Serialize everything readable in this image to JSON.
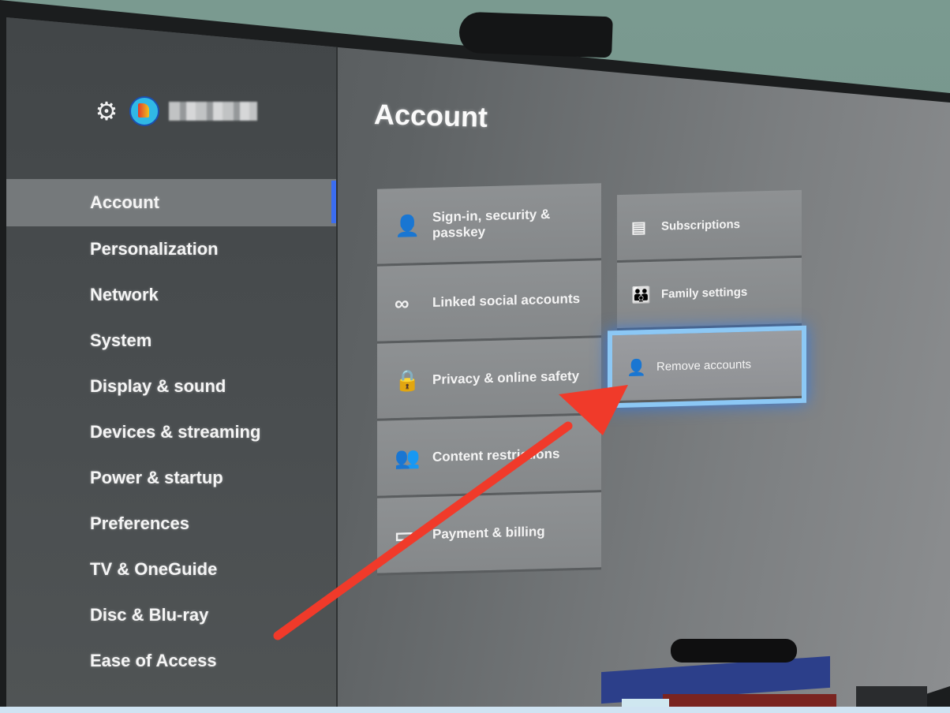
{
  "header": {
    "settings_icon": "gear-icon",
    "gamertag": "(blurred gamertag)"
  },
  "sidebar": {
    "items": [
      {
        "label": "Account",
        "selected": true
      },
      {
        "label": "Personalization"
      },
      {
        "label": "Network"
      },
      {
        "label": "System"
      },
      {
        "label": "Display & sound"
      },
      {
        "label": "Devices & streaming"
      },
      {
        "label": "Power & startup"
      },
      {
        "label": "Preferences"
      },
      {
        "label": "TV & OneGuide"
      },
      {
        "label": "Disc & Blu-ray"
      },
      {
        "label": "Ease of Access"
      }
    ],
    "accent_color": "#3b6df0"
  },
  "main": {
    "title": "Account",
    "left_tiles": [
      {
        "label": "Sign-in, security & passkey",
        "icon": "user-arrow-icon"
      },
      {
        "label": "Linked social accounts",
        "icon": "link-icon"
      },
      {
        "label": "Privacy & online safety",
        "icon": "lock-icon"
      },
      {
        "label": "Content restrictions",
        "icon": "family-lock-icon"
      },
      {
        "label": "Payment & billing",
        "icon": "wallet-icon"
      }
    ],
    "right_tiles": [
      {
        "label": "Subscriptions",
        "icon": "document-icon"
      },
      {
        "label": "Family settings",
        "icon": "family-icon"
      },
      {
        "label": "Remove accounts",
        "icon": "person-icon",
        "focused": true
      }
    ],
    "focus_color": "#8cc8f5"
  },
  "annotation": {
    "type": "arrow",
    "color": "#f03a2a",
    "points_to": "Remove accounts"
  }
}
